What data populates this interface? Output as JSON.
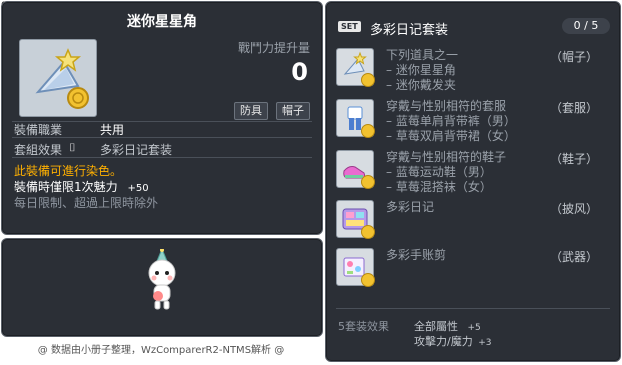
{
  "item_id": "01006940",
  "tooltip": {
    "title": "迷你星星角",
    "power_label": "戰鬥力提升量",
    "power_value": "0",
    "tags": [
      "防具",
      "帽子"
    ],
    "job_label": "裝備職業",
    "job_value": "共用",
    "set_label": "套組效果",
    "set_value": "多彩日记套装",
    "dye_text": "此裝備可進行染色。",
    "limit_text": "裝備時僅限1次魅力",
    "limit_value": "+50",
    "daily_text": "每日限制、超過上限時除外"
  },
  "credit": "@ 数据由小册子整理，WzComparerR2-NTMS解析 @",
  "set": {
    "badge": "SET",
    "title": "多彩日记套装",
    "count": "0 / 5",
    "items": [
      {
        "lines": [
          "下列道具之一",
          "– 迷你星星角",
          "– 迷你戴发夹"
        ],
        "slot": "（帽子）",
        "icon": "star-horn-icon"
      },
      {
        "lines": [
          "穿戴与性别相符的套服",
          "– 蓝莓单肩背带裤（男）",
          "– 草莓双肩背带裙（女）"
        ],
        "slot": "（套服）",
        "icon": "overall-icon"
      },
      {
        "lines": [
          "穿戴与性别相符的鞋子",
          "– 蓝莓运动鞋（男）",
          "– 草莓混搭袜（女）"
        ],
        "slot": "（鞋子）",
        "icon": "shoes-icon"
      },
      {
        "lines": [
          "多彩日记"
        ],
        "slot": "（披风）",
        "icon": "cape-icon"
      },
      {
        "lines": [
          "多彩手账剪"
        ],
        "slot": "（武器）",
        "icon": "weapon-icon"
      }
    ],
    "effect_label": "5套装效果",
    "effect_stats": [
      "全部屬性",
      "攻擊力/魔力"
    ],
    "effect_values": [
      "+5",
      "+3"
    ]
  },
  "colors": {
    "panel": "#2b2f36",
    "orange": "#ffb000"
  }
}
